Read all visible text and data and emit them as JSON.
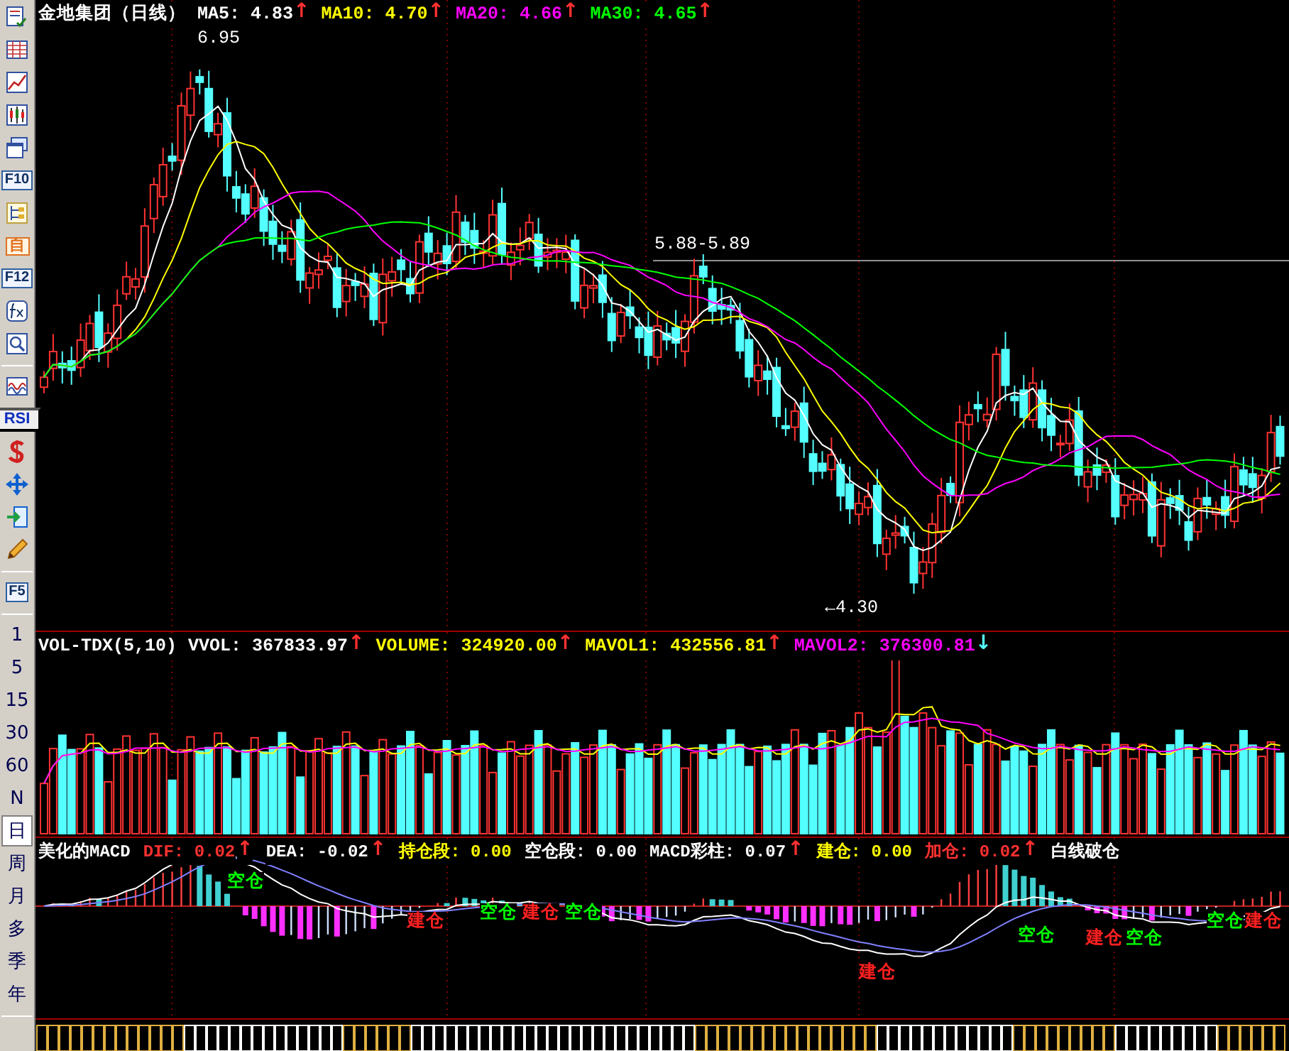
{
  "toolbar": {
    "labels": [
      {
        "text": "F10"
      },
      {
        "text": "自"
      },
      {
        "text": "F12"
      },
      {
        "text": "RSI"
      },
      {
        "text": "F5"
      }
    ],
    "periods": [
      {
        "label": "1",
        "selected": false
      },
      {
        "label": "5",
        "selected": false
      },
      {
        "label": "15",
        "selected": false
      },
      {
        "label": "30",
        "selected": false
      },
      {
        "label": "60",
        "selected": false
      },
      {
        "label": "N",
        "selected": false
      },
      {
        "label": "日",
        "selected": true
      },
      {
        "label": "周",
        "selected": false
      },
      {
        "label": "月",
        "selected": false
      },
      {
        "label": "多",
        "selected": false
      },
      {
        "label": "季",
        "selected": false
      },
      {
        "label": "年",
        "selected": false
      }
    ]
  },
  "price_panel": {
    "title": "金地集团（日线）",
    "indicators": [
      {
        "label": "MA5:",
        "value": "4.83",
        "arrow": {
          "text": "↑",
          "color": "#ff3030"
        },
        "color": "#ffffff"
      },
      {
        "label": "MA10:",
        "value": "4.70",
        "arrow": {
          "text": "↑",
          "color": "#ff3030"
        },
        "color": "#ffff00"
      },
      {
        "label": "MA20:",
        "value": "4.66",
        "arrow": {
          "text": "↑",
          "color": "#ff3030"
        },
        "color": "#ff00ff"
      },
      {
        "label": "MA30:",
        "value": "4.65",
        "arrow": {
          "text": "↑",
          "color": "#ff3030"
        },
        "color": "#00ff00"
      }
    ],
    "annotations": [
      {
        "text": "6.95"
      },
      {
        "text": "5.88-5.89"
      },
      {
        "text": "←4.30"
      }
    ]
  },
  "volume_panel": {
    "title": "VOL-TDX(5,10)",
    "indicators": [
      {
        "label": "VVOL:",
        "value": "367833.97",
        "arrow": {
          "text": "↑",
          "color": "#ff3030"
        },
        "color": "#ffffff"
      },
      {
        "label": "VOLUME:",
        "value": "324920.00",
        "arrow": {
          "text": "↑",
          "color": "#ff3030"
        },
        "color": "#ffff00"
      },
      {
        "label": "MAVOL1:",
        "value": "432556.81",
        "arrow": {
          "text": "↑",
          "color": "#ff3030"
        },
        "color": "#ffff00"
      },
      {
        "label": "MAVOL2:",
        "value": "376300.81",
        "arrow": {
          "text": "↓",
          "color": "#54ffff"
        },
        "color": "#ff00ff"
      }
    ]
  },
  "macd_panel": {
    "title": "美化的MACD",
    "indicators": [
      {
        "label": "DIF:",
        "value": "0.02",
        "arrow": {
          "text": "↑",
          "color": "#ff3030"
        },
        "color": "#ff3030"
      },
      {
        "label": "DEA:",
        "value": "-0.02",
        "arrow": {
          "text": "↑",
          "color": "#ff3030"
        },
        "color": "#ffffff"
      },
      {
        "label": "持仓段:",
        "value": "0.00",
        "color": "#ffff00"
      },
      {
        "label": "空仓段:",
        "value": "0.00",
        "color": "#ffffff"
      },
      {
        "label": "MACD彩柱:",
        "value": "0.07",
        "arrow": {
          "text": "↑",
          "color": "#ff3030"
        },
        "color": "#ffffff"
      },
      {
        "label": "建仓:",
        "value": "0.00",
        "color": "#ffff00"
      },
      {
        "label": "加仓:",
        "value": "0.02",
        "arrow": {
          "text": "↑",
          "color": "#ff3030"
        },
        "color": "#ff3030"
      },
      {
        "label": "白线破仓",
        "color": "#ffffff"
      }
    ],
    "signals": [
      {
        "text": "空仓",
        "color": "#00ff00"
      },
      {
        "text": "建仓",
        "color": "#ff2020"
      },
      {
        "text": "空仓",
        "color": "#00ff00"
      },
      {
        "text": "建仓",
        "color": "#ff2020"
      },
      {
        "text": "空仓",
        "color": "#00ff00"
      },
      {
        "text": "建仓",
        "color": "#ff2020"
      },
      {
        "text": "空仓",
        "color": "#00ff00"
      },
      {
        "text": "建仓",
        "color": "#ff2020"
      },
      {
        "text": "空仓",
        "color": "#00ff00"
      },
      {
        "text": "空仓",
        "color": "#00ff00"
      },
      {
        "text": "建仓",
        "color": "#ff2020"
      }
    ]
  }
}
